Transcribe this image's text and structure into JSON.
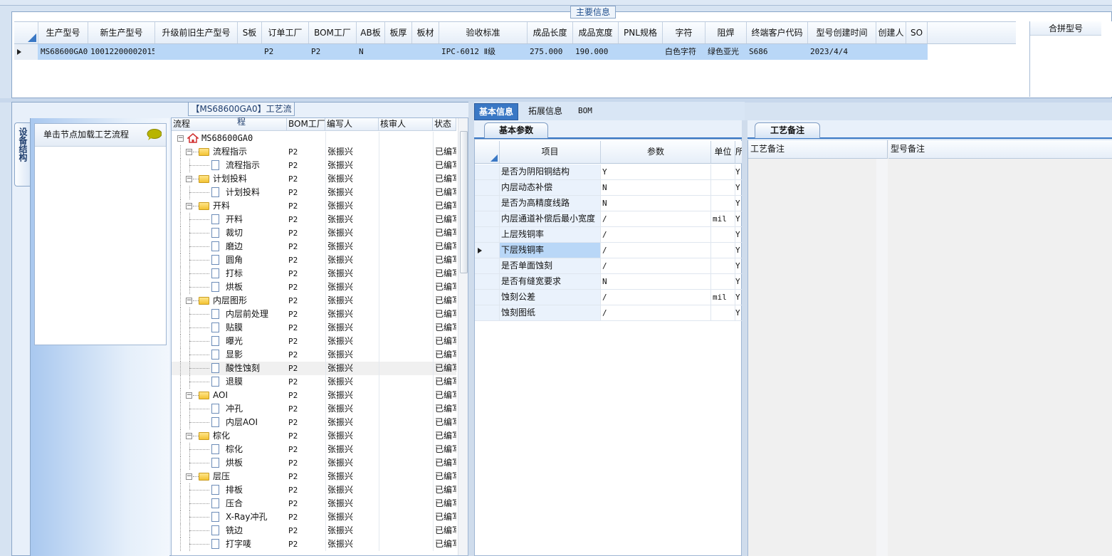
{
  "main_info": {
    "tab_label": "主要信息",
    "columns": [
      "生产型号",
      "新生产型号",
      "升级前旧生产型号",
      "S板",
      "订单工厂",
      "BOM工厂",
      "AB板",
      "板厚",
      "板材",
      "验收标准",
      "成品长度",
      "成品宽度",
      "PNL规格",
      "字符",
      "阻焊",
      "终端客户代码",
      "型号创建时间",
      "创建人",
      "SO"
    ],
    "row": [
      "MS68600GA0",
      "10012200002015",
      "",
      "",
      "P2",
      "P2",
      "N",
      "",
      "",
      "IPC-6012 Ⅱ级",
      "275.000",
      "190.000",
      "",
      "白色字符",
      "绿色亚光",
      "S686",
      "2023/4/4",
      "",
      ""
    ],
    "merge_header": "合拼型号"
  },
  "left_panel": {
    "vertical_tab": "设备结构",
    "equip_hint": "单击节点加载工艺流程"
  },
  "process_tree": {
    "title": "【MS68600GA0】工艺流程",
    "columns": [
      "流程",
      "BOM工厂",
      "编写人",
      "核审人",
      "状态"
    ],
    "nodes": [
      {
        "label": "MS68600GA0",
        "level": 0,
        "type": "root",
        "bom": "",
        "writer": "",
        "reviewer": "",
        "status": ""
      },
      {
        "label": "流程指示",
        "level": 1,
        "type": "folder",
        "bom": "P2",
        "writer": "张振兴",
        "reviewer": "",
        "status": "已编写"
      },
      {
        "label": "流程指示",
        "level": 2,
        "type": "doc",
        "bom": "P2",
        "writer": "张振兴",
        "reviewer": "",
        "status": "已编写"
      },
      {
        "label": "计划投料",
        "level": 1,
        "type": "folder",
        "bom": "P2",
        "writer": "张振兴",
        "reviewer": "",
        "status": "已编写"
      },
      {
        "label": "计划投料",
        "level": 2,
        "type": "doc",
        "bom": "P2",
        "writer": "张振兴",
        "reviewer": "",
        "status": "已编写"
      },
      {
        "label": "开料",
        "level": 1,
        "type": "folder",
        "bom": "P2",
        "writer": "张振兴",
        "reviewer": "",
        "status": "已编写"
      },
      {
        "label": "开料",
        "level": 2,
        "type": "doc",
        "bom": "P2",
        "writer": "张振兴",
        "reviewer": "",
        "status": "已编写"
      },
      {
        "label": "裁切",
        "level": 2,
        "type": "doc",
        "bom": "P2",
        "writer": "张振兴",
        "reviewer": "",
        "status": "已编写"
      },
      {
        "label": "磨边",
        "level": 2,
        "type": "doc",
        "bom": "P2",
        "writer": "张振兴",
        "reviewer": "",
        "status": "已编写"
      },
      {
        "label": "圆角",
        "level": 2,
        "type": "doc",
        "bom": "P2",
        "writer": "张振兴",
        "reviewer": "",
        "status": "已编写"
      },
      {
        "label": "打标",
        "level": 2,
        "type": "doc",
        "bom": "P2",
        "writer": "张振兴",
        "reviewer": "",
        "status": "已编写"
      },
      {
        "label": "烘板",
        "level": 2,
        "type": "doc",
        "bom": "P2",
        "writer": "张振兴",
        "reviewer": "",
        "status": "已编写"
      },
      {
        "label": "内层图形",
        "level": 1,
        "type": "folder",
        "bom": "P2",
        "writer": "张振兴",
        "reviewer": "",
        "status": "已编写"
      },
      {
        "label": "内层前处理",
        "level": 2,
        "type": "doc",
        "bom": "P2",
        "writer": "张振兴",
        "reviewer": "",
        "status": "已编写"
      },
      {
        "label": "贴膜",
        "level": 2,
        "type": "doc",
        "bom": "P2",
        "writer": "张振兴",
        "reviewer": "",
        "status": "已编写"
      },
      {
        "label": "曝光",
        "level": 2,
        "type": "doc",
        "bom": "P2",
        "writer": "张振兴",
        "reviewer": "",
        "status": "已编写"
      },
      {
        "label": "显影",
        "level": 2,
        "type": "doc",
        "bom": "P2",
        "writer": "张振兴",
        "reviewer": "",
        "status": "已编写"
      },
      {
        "label": "酸性蚀刻",
        "level": 2,
        "type": "doc",
        "bom": "P2",
        "writer": "张振兴",
        "reviewer": "",
        "status": "已编写",
        "selected": true
      },
      {
        "label": "退膜",
        "level": 2,
        "type": "doc",
        "bom": "P2",
        "writer": "张振兴",
        "reviewer": "",
        "status": "已编写"
      },
      {
        "label": "AOI",
        "level": 1,
        "type": "folder",
        "bom": "P2",
        "writer": "张振兴",
        "reviewer": "",
        "status": "已编写"
      },
      {
        "label": "冲孔",
        "level": 2,
        "type": "doc",
        "bom": "P2",
        "writer": "张振兴",
        "reviewer": "",
        "status": "已编写"
      },
      {
        "label": "内层AOI",
        "level": 2,
        "type": "doc",
        "bom": "P2",
        "writer": "张振兴",
        "reviewer": "",
        "status": "已编写"
      },
      {
        "label": "棕化",
        "level": 1,
        "type": "folder",
        "bom": "P2",
        "writer": "张振兴",
        "reviewer": "",
        "status": "已编写"
      },
      {
        "label": "棕化",
        "level": 2,
        "type": "doc",
        "bom": "P2",
        "writer": "张振兴",
        "reviewer": "",
        "status": "已编写"
      },
      {
        "label": "烘板",
        "level": 2,
        "type": "doc",
        "bom": "P2",
        "writer": "张振兴",
        "reviewer": "",
        "status": "已编写"
      },
      {
        "label": "层压",
        "level": 1,
        "type": "folder",
        "bom": "P2",
        "writer": "张振兴",
        "reviewer": "",
        "status": "已编写"
      },
      {
        "label": "排板",
        "level": 2,
        "type": "doc",
        "bom": "P2",
        "writer": "张振兴",
        "reviewer": "",
        "status": "已编写"
      },
      {
        "label": "压合",
        "level": 2,
        "type": "doc",
        "bom": "P2",
        "writer": "张振兴",
        "reviewer": "",
        "status": "已编写"
      },
      {
        "label": "X-Ray冲孔",
        "level": 2,
        "type": "doc",
        "bom": "P2",
        "writer": "张振兴",
        "reviewer": "",
        "status": "已编写"
      },
      {
        "label": "铣边",
        "level": 2,
        "type": "doc",
        "bom": "P2",
        "writer": "张振兴",
        "reviewer": "",
        "status": "已编写"
      },
      {
        "label": "打字唛",
        "level": 2,
        "type": "doc",
        "bom": "P2",
        "writer": "张振兴",
        "reviewer": "",
        "status": "已编写"
      }
    ]
  },
  "detail_tabs": [
    "基本信息",
    "拓展信息",
    "BOM"
  ],
  "basic_params": {
    "tab_label": "基本参数",
    "columns": [
      "项目",
      "参数",
      "单位",
      "所"
    ],
    "rows": [
      {
        "item": "是否为阴阳铜结构",
        "value": "Y",
        "unit": "",
        "req": "Y"
      },
      {
        "item": "内层动态补偿",
        "value": "N",
        "unit": "",
        "req": "Y"
      },
      {
        "item": "是否为高精度线路",
        "value": "N",
        "unit": "",
        "req": "Y"
      },
      {
        "item": "内层通道补偿后最小宽度",
        "value": "/",
        "unit": "mil",
        "req": "Y"
      },
      {
        "item": "上层残铜率",
        "value": "/",
        "unit": "",
        "req": "Y"
      },
      {
        "item": "下层残铜率",
        "value": "/",
        "unit": "",
        "req": "Y",
        "current": true
      },
      {
        "item": "是否单面蚀刻",
        "value": "/",
        "unit": "",
        "req": "Y"
      },
      {
        "item": "是否有缝宽要求",
        "value": "N",
        "unit": "",
        "req": "Y"
      },
      {
        "item": "蚀刻公差",
        "value": "/",
        "unit": "mil",
        "req": "Y"
      },
      {
        "item": "蚀刻图纸",
        "value": "/",
        "unit": "",
        "req": "Y"
      }
    ]
  },
  "remarks": {
    "tab_label": "工艺备注",
    "process_remark_header": "工艺备注",
    "model_remark_header": "型号备注"
  }
}
